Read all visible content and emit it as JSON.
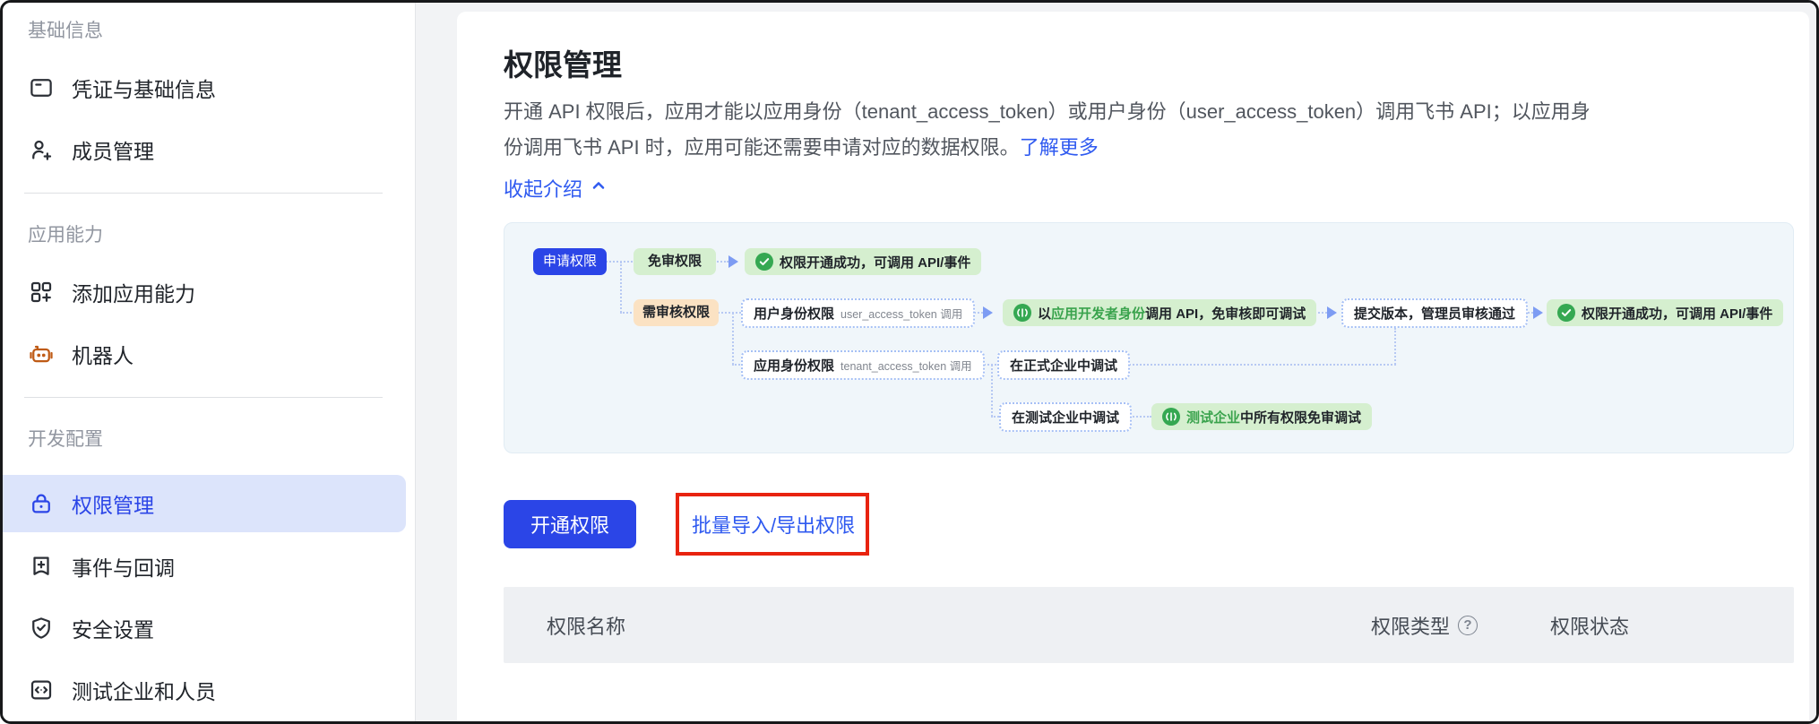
{
  "sidebar": {
    "sections": [
      {
        "header": "基础信息",
        "items": [
          {
            "label": "凭证与基础信息",
            "icon": "id-card-icon"
          },
          {
            "label": "成员管理",
            "icon": "user-add-icon"
          }
        ]
      },
      {
        "header": "应用能力",
        "items": [
          {
            "label": "添加应用能力",
            "icon": "grid-add-icon"
          },
          {
            "label": "机器人",
            "icon": "robot-icon",
            "icon_color": "#bf5b16"
          }
        ]
      },
      {
        "header": "开发配置",
        "items": [
          {
            "label": "权限管理",
            "icon": "lock-icon",
            "selected": true
          },
          {
            "label": "事件与回调",
            "icon": "bookmark-add-icon"
          },
          {
            "label": "安全设置",
            "icon": "shield-check-icon"
          },
          {
            "label": "测试企业和人员",
            "icon": "code-box-icon"
          }
        ]
      }
    ]
  },
  "header": {
    "title": "权限管理",
    "description_line1": "开通 API 权限后，应用才能以应用身份（tenant_access_token）或用户身份（user_access_token）调用飞书 API；以应用身",
    "description_line2": "份调用飞书 API 时，应用可能还需要申请对应的数据权限。",
    "learn_more": "了解更多",
    "collapse": "收起介绍"
  },
  "flow": {
    "apply": "申请权限",
    "no_review": "免审权限",
    "success1": "权限开通成功，可调用 API/事件",
    "need_review": "需审核权限",
    "user_perm": {
      "title": "用户身份权限",
      "note": "user_access_token 调用"
    },
    "dev_debug": {
      "pre": "以",
      "highlight": "应用开发者身份",
      "post": "调用 API，免审核即可调试"
    },
    "tenant_perm": {
      "title": "应用身份权限",
      "note": "tenant_access_token 调用"
    },
    "official_debug": "在正式企业中调试",
    "submit": "提交版本，管理员审核通过",
    "success2": "权限开通成功，可调用 API/事件",
    "test_debug": "在测试企业中调试",
    "test_all": {
      "highlight": "测试企业",
      "post": "中所有权限免审调试"
    }
  },
  "actions": {
    "open": "开通权限",
    "batch": "批量导入/导出权限"
  },
  "table": {
    "columns": [
      "权限名称",
      "权限类型",
      "权限状态"
    ]
  },
  "colors": {
    "primary_blue": "#2b45e7",
    "link_blue": "#2f5af0",
    "selected_item_bg": "#dce4fb",
    "green_box_bg": "#d5efcf",
    "green_icon": "#35a852",
    "green_text": "#3aa34d",
    "orange_badge_bg": "#fbe2c3",
    "flow_bg": "#f0f6fa",
    "connector_blue": "#b7c9f3",
    "table_header_bg": "#eef0f3",
    "robot_icon": "#bf5b16",
    "annotation_red": "#e8230f"
  }
}
